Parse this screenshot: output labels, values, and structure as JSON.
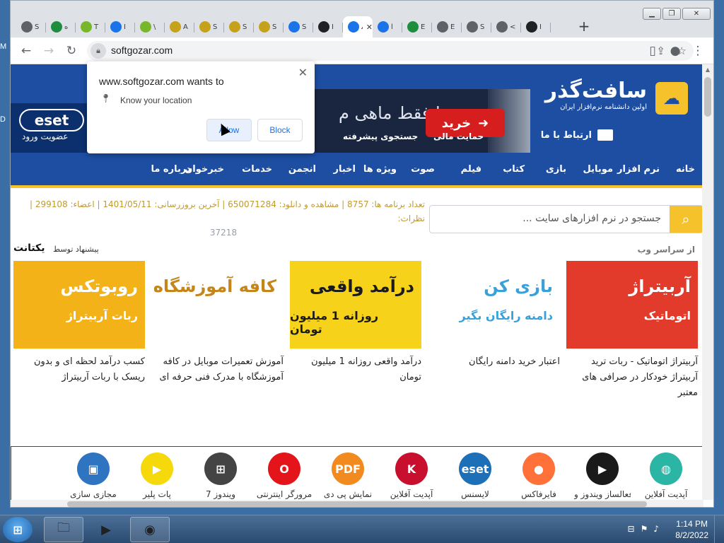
{
  "desktop": {
    "edge_chars": [
      "M",
      "D"
    ]
  },
  "browser": {
    "tabs": [
      {
        "icon": "chrome-icon",
        "title": "S",
        "color": "#5f6368"
      },
      {
        "icon": "bookmark-icon",
        "title": "ه",
        "color": "#1e8e3e"
      },
      {
        "icon": "utorrent-icon",
        "title": "T",
        "color": "#76b82a"
      },
      {
        "icon": "download-icon",
        "title": "I",
        "color": "#1a73e8"
      },
      {
        "icon": "utorrent-icon",
        "title": "\\",
        "color": "#76b82a"
      },
      {
        "icon": "bird-icon",
        "title": "A",
        "color": "#c5a21a"
      },
      {
        "icon": "bird-icon",
        "title": "S",
        "color": "#c5a21a"
      },
      {
        "icon": "bird-icon",
        "title": "S",
        "color": "#c5a21a"
      },
      {
        "icon": "bird-icon",
        "title": "S",
        "color": "#c5a21a"
      },
      {
        "icon": "window-icon",
        "title": "S",
        "color": "#1a73e8"
      },
      {
        "icon": "github-icon",
        "title": "I",
        "color": "#202124"
      },
      {
        "icon": "loading-icon",
        "title": "ﺳ",
        "color": "#1a73e8",
        "active": true
      },
      {
        "icon": "loading-icon",
        "title": "ا",
        "color": "#1a73e8"
      },
      {
        "icon": "chip-icon",
        "title": "E",
        "color": "#1e8e3e"
      },
      {
        "icon": "chrome-icon",
        "title": "E",
        "color": "#5f6368"
      },
      {
        "icon": "chrome-icon",
        "title": "S",
        "color": "#5f6368"
      },
      {
        "icon": "chrome-icon",
        "title": "<",
        "color": "#5f6368"
      },
      {
        "icon": "github-icon",
        "title": "I",
        "color": "#202124"
      }
    ],
    "url": "softgozar.com"
  },
  "popup": {
    "title": "www.softgozar.com wants to",
    "permission": "Know your location",
    "allow_label": "Allow",
    "block_label": "Block"
  },
  "site": {
    "name": "سافت‌گذر",
    "tagline": "اولین دانشنامه نرم‌افزار ایران",
    "contact": "ارتباط با ما",
    "buy": "خرید",
    "financial_support": "حمایت مالی",
    "advanced_search": "جستجوی پیشرفته",
    "banner_text": "با فقط ماهی م",
    "eset": "eset",
    "login": "عضویت   ورود",
    "nav": [
      "خانه",
      "نرم افزار",
      "موبایل",
      "بازی",
      "کتاب",
      "فیلم",
      "صوت",
      "ویژه ها",
      "اخبار",
      "انجمن",
      "خدمات",
      "خبرخوان",
      "درباره ما"
    ],
    "stats_line1": "تعداد برنامه ها: 8757 | مشاهده و دانلود: 650071284 | آخرین بروزرسانی: 1401/05/11 | اعضاء: 299108 | نظرات:",
    "stats_line2": "37218",
    "search_placeholder": "جستجو در نرم افزارهای سایت ...",
    "section_right": "از سراسر وب",
    "section_left": "پیشنهاد توسط",
    "section_logo": "یکتانت",
    "cards": [
      {
        "t1": "آربیتراژ",
        "t2": "اتوماتیک",
        "bg": "#e23b2b",
        "fg": "#ffffff",
        "caption": "آربیتراژ اتوماتیک - ربات ترید آربیتراژ خودکار در صرافی های معتبر"
      },
      {
        "t1": "بازی کن",
        "t2": "دامنه رایگان بگیر",
        "bg": "#ffffff",
        "fg": "#3aa0d8",
        "caption": "اعتبار خرید دامنه رایگان"
      },
      {
        "t1": "درآمد واقعی",
        "t2": "روزانه 1 میلیون تومان",
        "bg": "#f6d21a",
        "fg": "#1b1b1b",
        "caption": "درآمد واقعی روزانه 1 میلیون تومان"
      },
      {
        "t1": "کافه آموزشگاه",
        "t2": "",
        "bg": "#ffffff",
        "fg": "#c4861a",
        "caption": "آموزش تعمیرات موبایل در کافه آموزشگاه با مدرک فنی حرفه ای"
      },
      {
        "t1": "روبوتکس",
        "t2": "ربات آربیتراژ",
        "bg": "#f2b218",
        "fg": "#ffffff",
        "caption": "کسب درآمد لحظه ای و بدون ریسک با ربات آربیتراژ"
      }
    ],
    "apps": [
      {
        "icon": "globe-icon",
        "label": "آپدیت آفلاین",
        "bg": "#2bb5a4",
        "glyph": "◍"
      },
      {
        "icon": "windows-activator-icon",
        "label": "فعالساز ویندوز و",
        "bg": "#1a1a1a",
        "glyph": "▶"
      },
      {
        "icon": "firefox-icon",
        "label": "فایرفاکس",
        "bg": "#ff7139",
        "glyph": "●"
      },
      {
        "icon": "eset-icon",
        "label": "لایسنس",
        "bg": "#1d6fb8",
        "glyph": "eset"
      },
      {
        "icon": "kaspersky-icon",
        "label": "آپدیت آفلاین",
        "bg": "#c8102e",
        "glyph": "K"
      },
      {
        "icon": "pdf-icon",
        "label": "نمایش پی دی",
        "bg": "#f28b1f",
        "glyph": "PDF"
      },
      {
        "icon": "opera-icon",
        "label": "مرورگر اینترنتی",
        "bg": "#e4141b",
        "glyph": "O"
      },
      {
        "icon": "windows7-icon",
        "label": "ویندوز 7",
        "bg": "#444444",
        "glyph": "⊞"
      },
      {
        "icon": "player-icon",
        "label": "پات پلیر",
        "bg": "#f5d90a",
        "glyph": "▶"
      },
      {
        "icon": "virtualbox-icon",
        "label": "مجازی سازی",
        "bg": "#2f74c0",
        "glyph": "▣"
      }
    ]
  },
  "taskbar": {
    "time": "1:14 PM",
    "date": "8/2/2022"
  }
}
